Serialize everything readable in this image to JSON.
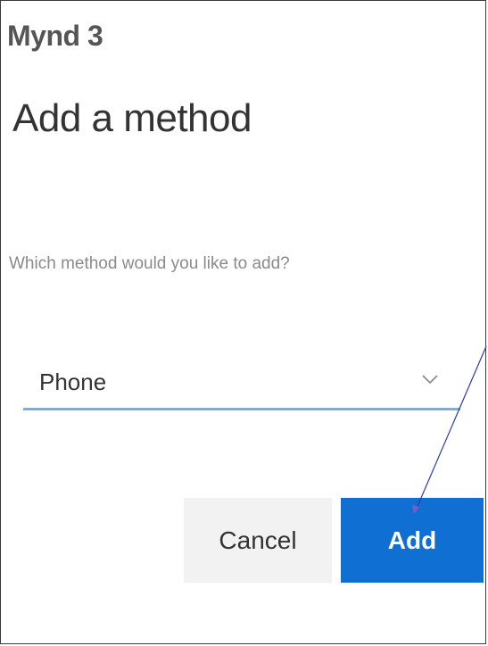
{
  "screenshot_label": "Mynd 3",
  "dialog": {
    "title": "Add a method",
    "question": "Which method would you like to add?",
    "method_select": {
      "selected_value": "Phone",
      "accent_color": "#6cb3ec"
    },
    "buttons": {
      "cancel_label": "Cancel",
      "add_label": "Add",
      "add_color": "#0f6fd2"
    }
  },
  "icons": {
    "dropdown": "chevron-down-icon"
  }
}
